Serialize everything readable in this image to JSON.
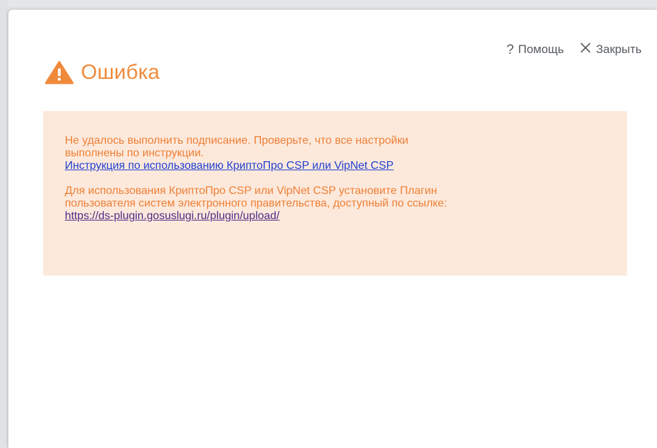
{
  "dialog": {
    "title": "Ошибка",
    "actions": {
      "help_label": "Помощь",
      "close_label": "Закрыть"
    }
  },
  "message": {
    "paragraph1_line1": "Не удалось выполнить подписание. Проверьте, что все настройки",
    "paragraph1_line2": "выполнены по инструкции.",
    "instruction_link": "Инструкция по использованию КриптоПро CSP или VipNet CSP",
    "paragraph2_line1": "Для использования КриптоПро CSP или VipNet CSP установите Плагин",
    "paragraph2_line2": "пользователя систем электронного правительства, доступный по ссылке:",
    "plugin_link": "https://ds-plugin.gosuslugi.ru/plugin/upload/"
  },
  "colors": {
    "accent": "#f08a3b",
    "panel_background": "#fde9dc",
    "message_text": "#ee7f35",
    "link": "#1f3fd1",
    "visited_link": "#4b2c86"
  },
  "icons": {
    "title_icon": "warning-triangle-icon",
    "help_icon": "question-mark-icon",
    "close_icon": "close-x-icon"
  }
}
